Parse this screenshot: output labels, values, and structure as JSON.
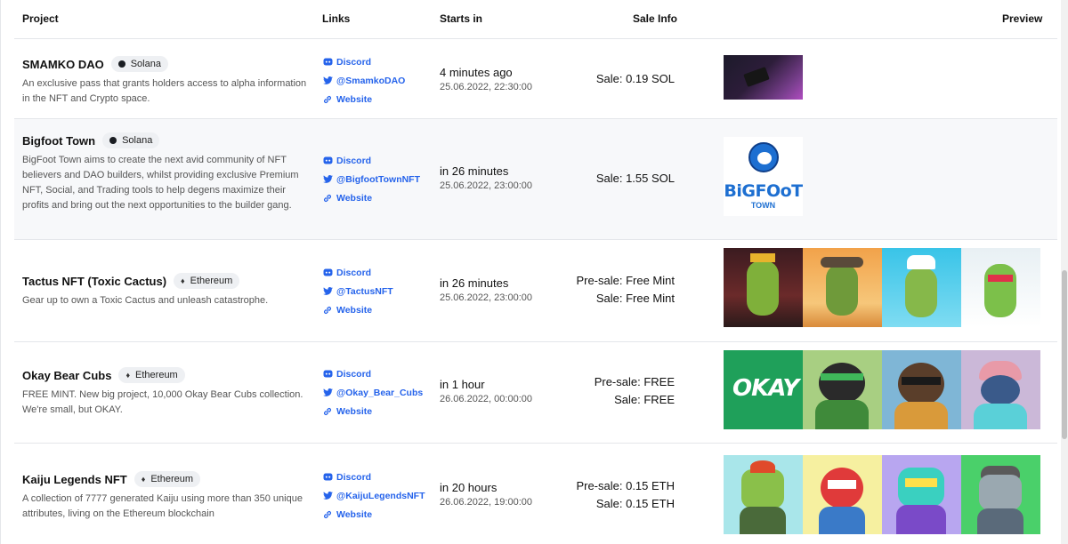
{
  "headers": {
    "project": "Project",
    "links": "Links",
    "starts": "Starts in",
    "sale": "Sale Info",
    "preview": "Preview"
  },
  "link_labels": {
    "discord": "Discord",
    "website": "Website"
  },
  "rows": [
    {
      "name": "SMAMKO DAO",
      "chain": "Solana",
      "desc": "An exclusive pass that grants holders access to alpha information in the NFT and Crypto space.",
      "twitter": "@SmamkoDAO",
      "starts_rel": "4 minutes ago",
      "starts_abs": "25.06.2022, 22:30:00",
      "presale": "",
      "sale": "Sale: 0.19 SOL"
    },
    {
      "name": "Bigfoot Town",
      "chain": "Solana",
      "desc": "BigFoot Town aims to create the next avid community of NFT believers and DAO builders, whilst providing exclusive Premium NFT, Social, and Trading tools to help degens maximize their profits and bring out the next opportunities to the builder gang.",
      "twitter": "@BigfootTownNFT",
      "starts_rel": "in 26 minutes",
      "starts_abs": "25.06.2022, 23:00:00",
      "presale": "",
      "sale": "Sale: 1.55 SOL",
      "logo_text": "BiGFOoT",
      "logo_sub": "TOWN"
    },
    {
      "name": "Tactus NFT (Toxic Cactus)",
      "chain": "Ethereum",
      "desc": "Gear up to own a Toxic Cactus and unleash catastrophe.",
      "twitter": "@TactusNFT",
      "starts_rel": "in 26 minutes",
      "starts_abs": "25.06.2022, 23:00:00",
      "presale": "Pre-sale: Free Mint",
      "sale": "Sale: Free Mint"
    },
    {
      "name": "Okay Bear Cubs",
      "chain": "Ethereum",
      "desc": "FREE MINT. New big project, 10,000 Okay Bear Cubs collection. We're small, but OKAY.",
      "twitter": "@Okay_Bear_Cubs",
      "starts_rel": "in 1 hour",
      "starts_abs": "26.06.2022, 00:00:00",
      "presale": "Pre-sale: FREE",
      "sale": "Sale: FREE",
      "logo_text": "OKAY"
    },
    {
      "name": "Kaiju Legends NFT",
      "chain": "Ethereum",
      "desc": "A collection of 7777 generated Kaiju using more than 350 unique attributes, living on the Ethereum blockchain",
      "twitter": "@KaijuLegendsNFT",
      "starts_rel": "in 20 hours",
      "starts_abs": "26.06.2022, 19:00:00",
      "presale": "Pre-sale: 0.15 ETH",
      "sale": "Sale: 0.15 ETH"
    }
  ],
  "colors": {
    "link": "#2563eb",
    "row_alt": "#f7f8fa",
    "border": "#e4e6ea"
  },
  "icons": {
    "discord": "discord-icon",
    "twitter": "twitter-icon",
    "website": "link-icon",
    "solana": "solana-dot-icon",
    "ethereum": "ethereum-icon"
  }
}
